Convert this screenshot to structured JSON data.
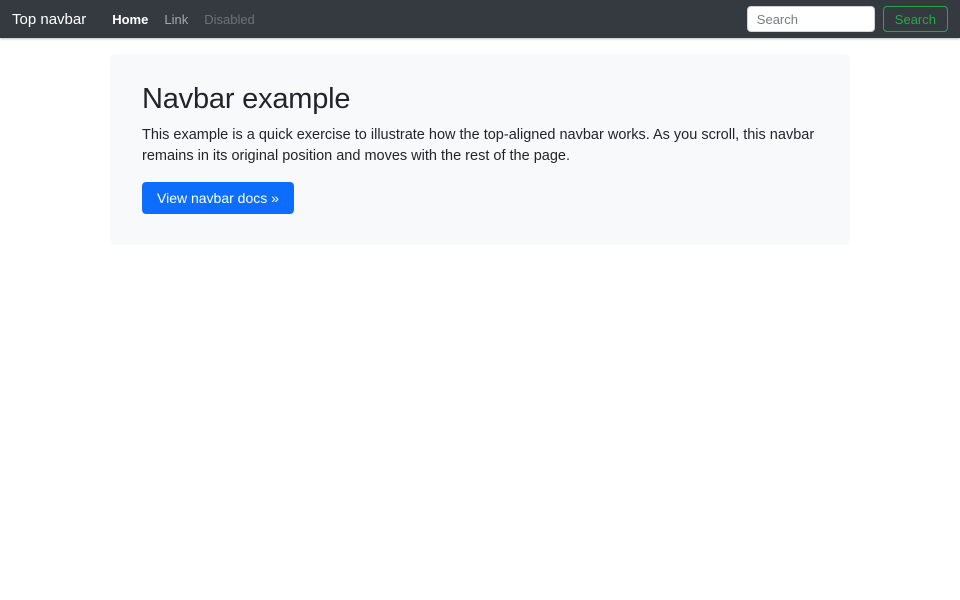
{
  "navbar": {
    "brand": "Top navbar",
    "items": [
      {
        "label": "Home",
        "state": "active"
      },
      {
        "label": "Link",
        "state": "default"
      },
      {
        "label": "Disabled",
        "state": "disabled"
      }
    ],
    "search": {
      "placeholder": "Search",
      "value": "",
      "button_label": "Search"
    }
  },
  "main": {
    "heading": "Navbar example",
    "description": "This example is a quick exercise to illustrate how the top-aligned navbar works. As you scroll, this navbar remains in its original position and moves with the rest of the page.",
    "cta_label": "View navbar docs »"
  },
  "colors": {
    "navbar_bg": "#343a40",
    "navbar_link_active": "#ffffff",
    "navbar_link_muted": "rgba(255,255,255,0.55)",
    "navbar_link_disabled": "rgba(255,255,255,0.28)",
    "success_green": "#28a745",
    "primary_blue": "#0d6efd",
    "hero_bg": "#f8f9fa",
    "text": "#212529"
  }
}
